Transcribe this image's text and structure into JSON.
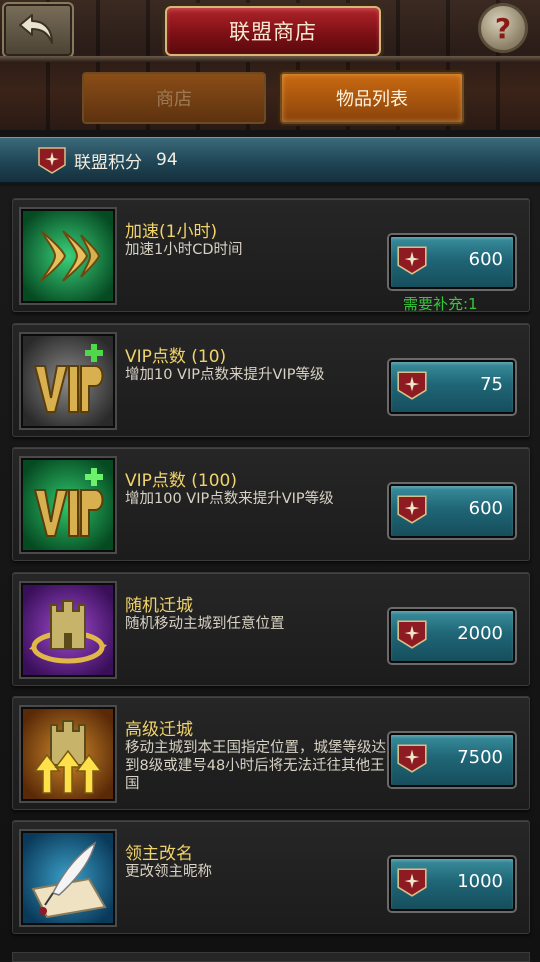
{
  "header": {
    "title": "联盟商店",
    "help_glyph": "?",
    "back_icon": "back-arrow-icon"
  },
  "tabs": [
    {
      "label": "商店",
      "active": false
    },
    {
      "label": "物品列表",
      "active": true
    }
  ],
  "points": {
    "label": "联盟积分",
    "value": "94",
    "icon": "alliance-emblem-icon"
  },
  "items": [
    {
      "name": "加速(1小时)",
      "desc": "加速1小时CD时间",
      "price": "600",
      "note": "需要补充:1",
      "icon": "speedup-chevrons-icon"
    },
    {
      "name": "VIP点数 (10)",
      "desc": "增加10  VIP点数来提升VIP等级",
      "price": "75",
      "note": "",
      "icon": "vip-points-icon"
    },
    {
      "name": "VIP点数 (100)",
      "desc": "增加100  VIP点数来提升VIP等级",
      "price": "600",
      "note": "",
      "icon": "vip-points-icon"
    },
    {
      "name": "随机迁城",
      "desc": "随机移动主城到任意位置",
      "price": "2000",
      "note": "",
      "icon": "random-teleport-castle-icon"
    },
    {
      "name": "高级迁城",
      "desc": "移动主城到本王国指定位置，城堡等级达到8级或建号48小时后将无法迁往其他王国",
      "price": "7500",
      "note": "",
      "icon": "advanced-teleport-castle-icon"
    },
    {
      "name": "领主改名",
      "desc": "更改领主昵称",
      "price": "1000",
      "note": "",
      "icon": "quill-scroll-icon"
    }
  ],
  "colors": {
    "title_red": "#7a0f14",
    "tab_active": "#c96a12",
    "banner_teal": "#1f4656",
    "price_button": "#1f6677",
    "item_name_gold": "#f0d36a",
    "note_green": "#39c43c"
  }
}
